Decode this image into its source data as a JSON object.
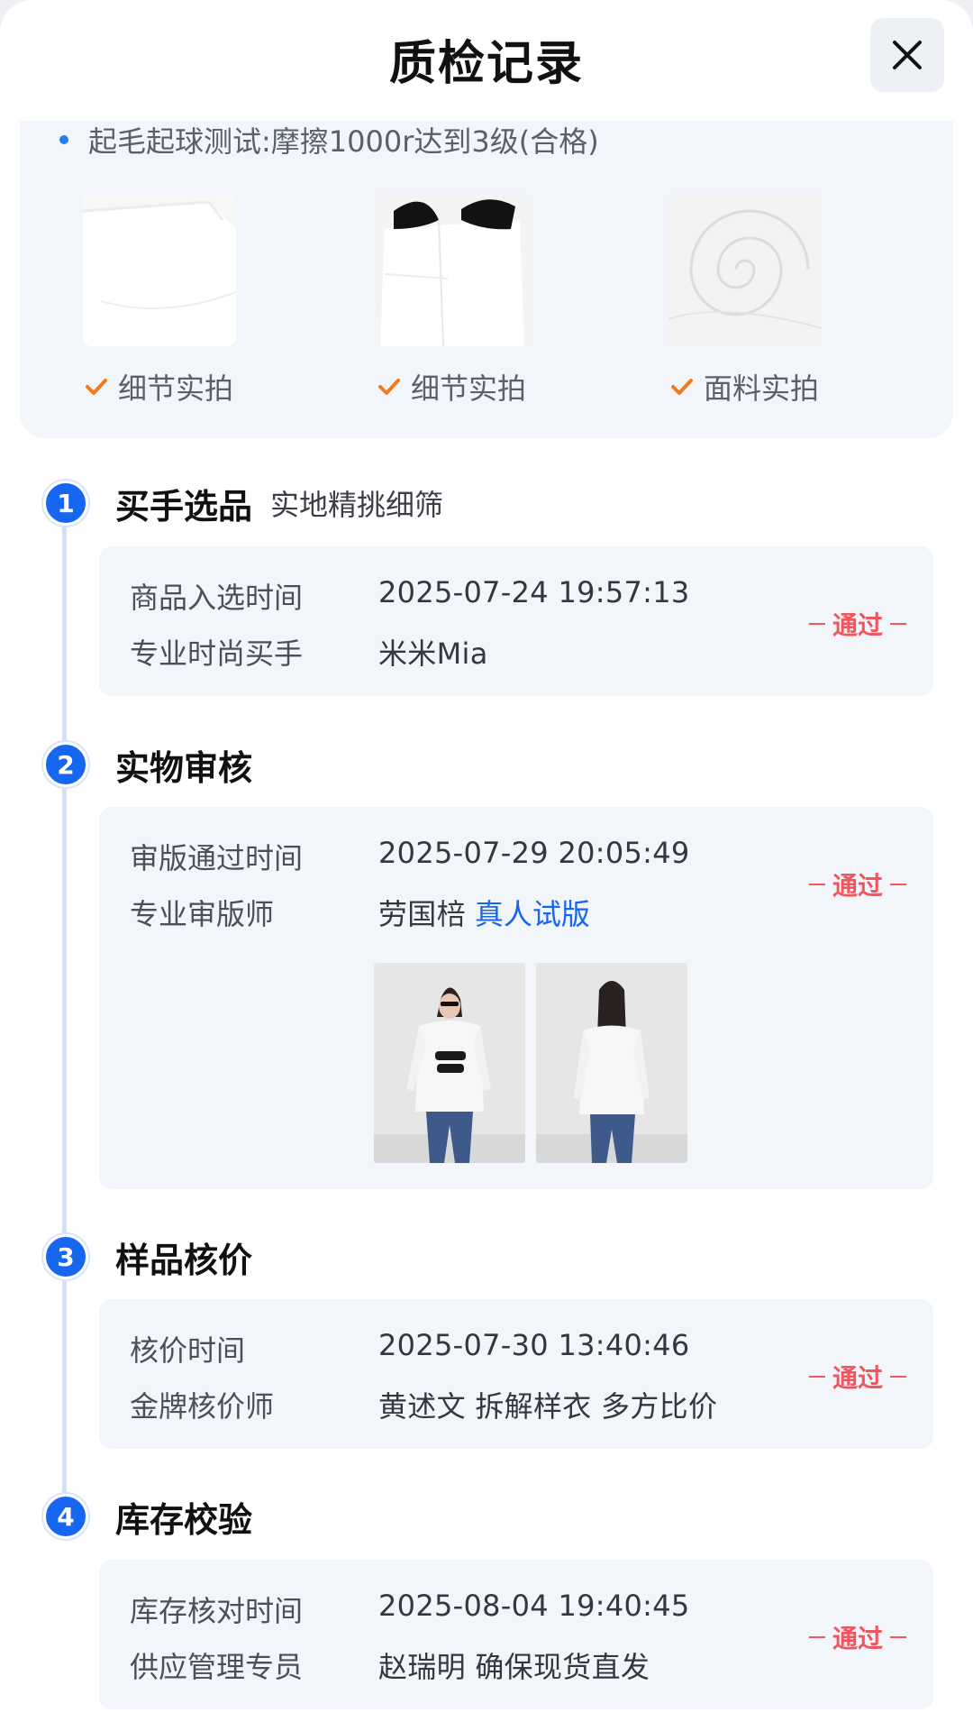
{
  "header": {
    "title": "质检记录"
  },
  "top_card": {
    "bullet": "起毛起球测试:摩擦1000r达到3级(合格)",
    "photos": [
      {
        "label": "细节实拍",
        "icon": "check-icon"
      },
      {
        "label": "细节实拍",
        "icon": "check-icon"
      },
      {
        "label": "面料实拍",
        "icon": "check-icon"
      }
    ]
  },
  "steps": [
    {
      "num": "1",
      "title": "买手选品",
      "subtitle": "实地精挑细筛",
      "rows": [
        {
          "key": "商品入选时间",
          "value": "2025-07-24 19:57:13"
        },
        {
          "key": "专业时尚买手",
          "value": "米米Mia"
        }
      ],
      "status": "通过"
    },
    {
      "num": "2",
      "title": "实物审核",
      "subtitle": "",
      "rows": [
        {
          "key": "审版通过时间",
          "value": "2025-07-29 20:05:49"
        },
        {
          "key": "专业审版师",
          "value": "劳国棓",
          "link": "真人试版"
        }
      ],
      "status": "通过"
    },
    {
      "num": "3",
      "title": "样品核价",
      "subtitle": "",
      "rows": [
        {
          "key": "核价时间",
          "value": "2025-07-30 13:40:46"
        },
        {
          "key": "金牌核价师",
          "value": "黄述文 拆解样衣 多方比价"
        }
      ],
      "status": "通过"
    },
    {
      "num": "4",
      "title": "库存校验",
      "subtitle": "",
      "rows": [
        {
          "key": "库存核对时间",
          "value": "2025-08-04 19:40:45"
        },
        {
          "key": "供应管理专员",
          "value": "赵瑞明 确保现货直发"
        }
      ],
      "status": "通过"
    }
  ],
  "colors": {
    "accent": "#1666f0",
    "pass": "#f2565d",
    "check": "#f07b1e",
    "card_bg": "#f2f5f9"
  }
}
